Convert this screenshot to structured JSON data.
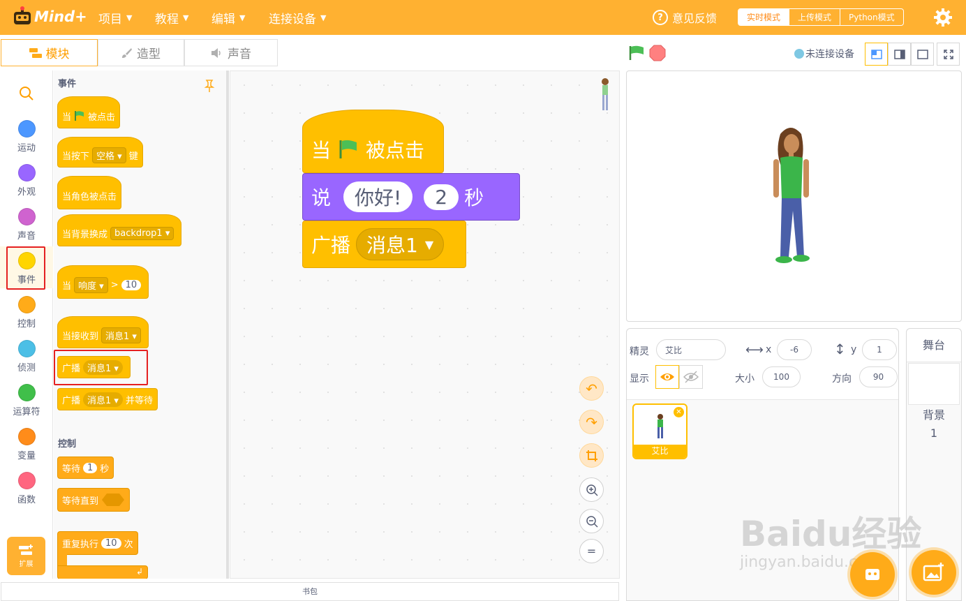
{
  "app": {
    "logo_text": "Mind+"
  },
  "menu": [
    {
      "label": "项目"
    },
    {
      "label": "教程"
    },
    {
      "label": "编辑"
    },
    {
      "label": "连接设备"
    }
  ],
  "feedback_label": "意见反馈",
  "modes": [
    {
      "label": "实时模式",
      "active": true
    },
    {
      "label": "上传模式",
      "active": false
    },
    {
      "label": "Python模式",
      "active": false
    }
  ],
  "tabs": [
    {
      "label": "模块",
      "active": true
    },
    {
      "label": "造型",
      "active": false
    },
    {
      "label": "声音",
      "active": false
    }
  ],
  "categories": [
    {
      "label": "运动",
      "color": "#4c97ff"
    },
    {
      "label": "外观",
      "color": "#9966ff"
    },
    {
      "label": "声音",
      "color": "#cf63cf"
    },
    {
      "label": "事件",
      "color": "#ffd500"
    },
    {
      "label": "控制",
      "color": "#ffab19"
    },
    {
      "label": "侦测",
      "color": "#4cbfe6"
    },
    {
      "label": "运算符",
      "color": "#40bf4a"
    },
    {
      "label": "变量",
      "color": "#ff8c1a"
    },
    {
      "label": "函数",
      "color": "#ff6680"
    }
  ],
  "extension_label": "扩展",
  "palette": {
    "events_title": "事件",
    "control_title": "控制",
    "when_flag": {
      "pre": "当",
      "post": "被点击"
    },
    "when_key": {
      "pre": "当按下",
      "key": "空格",
      "post": "键"
    },
    "when_sprite_clicked": "当角色被点击",
    "when_backdrop": {
      "pre": "当背景换成",
      "value": "backdrop1"
    },
    "when_gt": {
      "pre": "当",
      "sensor": "响度",
      "op": ">",
      "value": "10"
    },
    "when_receive": {
      "pre": "当接收到",
      "value": "消息1"
    },
    "broadcast": {
      "pre": "广播",
      "value": "消息1"
    },
    "broadcast_wait": {
      "pre": "广播",
      "value": "消息1",
      "post": "并等待"
    },
    "wait": {
      "pre": "等待",
      "value": "1",
      "post": "秒"
    },
    "wait_until": "等待直到",
    "repeat": {
      "pre": "重复执行",
      "value": "10",
      "post": "次"
    }
  },
  "script": {
    "hat": {
      "pre": "当",
      "post": "被点击"
    },
    "say": {
      "pre": "说",
      "text": "你好!",
      "secs": "2",
      "post": "秒"
    },
    "broadcast": {
      "pre": "广播",
      "value": "消息1"
    }
  },
  "backpack_label": "书包",
  "connection_status": "未连接设备",
  "sprite_info": {
    "sprite_label": "精灵",
    "sprite_name": "艾比",
    "x_label": "x",
    "x": "-6",
    "y_label": "y",
    "y": "1",
    "show_label": "显示",
    "size_label": "大小",
    "size": "100",
    "direction_label": "方向",
    "direction": "90"
  },
  "sprite_thumb_name": "艾比",
  "stage_panel": {
    "title": "舞台",
    "backdrop_label": "背景",
    "backdrop_count": "1"
  },
  "watermark": {
    "main": "Baidu经验",
    "sub": "jingyan.baidu.com"
  }
}
